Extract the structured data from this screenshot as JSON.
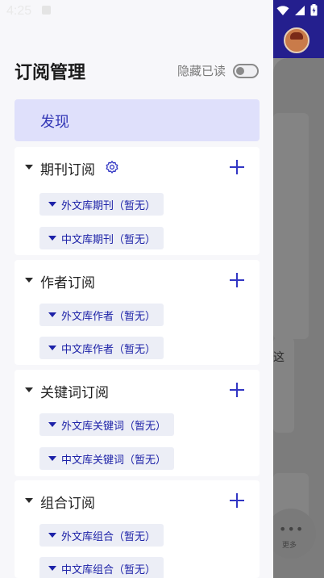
{
  "status_bar": {
    "time": "4:25"
  },
  "drawer": {
    "title": "订阅管理",
    "hide_read_label": "隐藏已读",
    "hide_read_on": false,
    "discover_label": "发现",
    "sections": [
      {
        "title": "期刊订阅",
        "has_settings": true,
        "items": [
          "外文库期刊（暂无）",
          "中文库期刊（暂无）"
        ]
      },
      {
        "title": "作者订阅",
        "has_settings": false,
        "items": [
          "外文库作者（暂无）",
          "中文库作者（暂无）"
        ]
      },
      {
        "title": "关键词订阅",
        "has_settings": false,
        "items": [
          "外文库关键词（暂无）",
          "中文库关键词（暂无）"
        ]
      },
      {
        "title": "组合订阅",
        "has_settings": false,
        "items": [
          "外文库组合（暂无）",
          "中文库组合（暂无）"
        ]
      }
    ]
  },
  "background": {
    "partial_text": "这",
    "more_label": "更多"
  },
  "colors": {
    "accent": "#3236c4",
    "header": "#241f8e",
    "discover_bg": "#dfe0fb",
    "chip_bg": "#eceef6"
  },
  "icons": {
    "section_settings": "gear-icon",
    "section_add": "plus-icon",
    "section_expand": "caret-down-icon"
  }
}
